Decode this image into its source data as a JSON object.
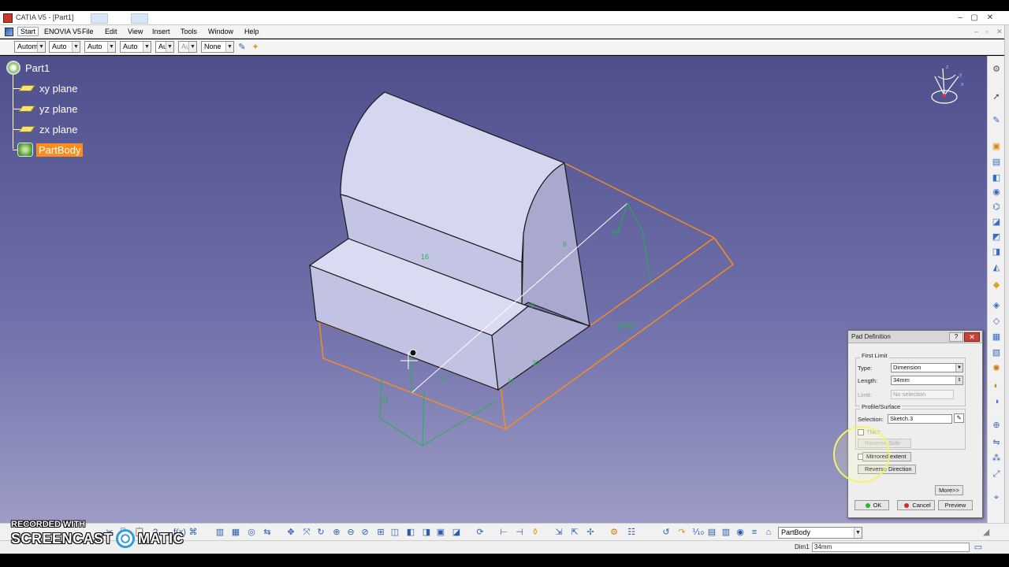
{
  "window": {
    "title": "CATIA V5 - [Part1]",
    "controls": [
      "–",
      "▢",
      "✕"
    ],
    "mdi_controls": [
      "–",
      "▫",
      "✕"
    ]
  },
  "menu": {
    "items": [
      "Start",
      "ENOVIA V5",
      "File",
      "Edit",
      "View",
      "Insert",
      "Tools",
      "Window",
      "Help"
    ]
  },
  "toolbar": {
    "combos": [
      {
        "value": "Automa",
        "disabled": false
      },
      {
        "value": "Auto",
        "disabled": false
      },
      {
        "value": "Auto",
        "disabled": false
      },
      {
        "value": "Auto",
        "disabled": false
      },
      {
        "value": "Aut",
        "disabled": false
      },
      {
        "value": "Aut",
        "disabled": true
      },
      {
        "value": "None",
        "disabled": false
      }
    ]
  },
  "tree": {
    "root": "Part1",
    "children": [
      "xy plane",
      "yz plane",
      "zx plane"
    ],
    "body": "PartBody"
  },
  "dimensions": {
    "lim1": "LIM1"
  },
  "dialog": {
    "title": "Pad Definition",
    "help": "?",
    "close": "✕",
    "first_limit": {
      "group": "First Limit",
      "type_label": "Type:",
      "type_value": "Dimension",
      "length_label": "Length:",
      "length_value": "34mm",
      "limit_label": "Limit:",
      "limit_value": "No selection"
    },
    "profile": {
      "group": "Profile/Surface",
      "selection_label": "Selection:",
      "selection_value": "Sketch.3",
      "thick_label": "Thick",
      "reverse_side": "Reverse Side"
    },
    "mirrored_extent": "Mirrored extent",
    "reverse_direction": "Reverse Direction",
    "more": "More>>",
    "ok": "OK",
    "cancel": "Cancel",
    "preview": "Preview"
  },
  "status": {
    "dim_label": "Dim1",
    "dim_value": "34mm",
    "body_select": "PartBody"
  },
  "watermark": {
    "line1": "RECORDED WITH",
    "line2a": "SCREENCAST",
    "line2b": "MATIC"
  },
  "colors": {
    "viewport_top": "#4f4f8c",
    "viewport_bottom": "#9c9cc6",
    "preview_orange": "#ff8c1a",
    "constraint_green": "#22b14c",
    "highlight": "#ff8c1a"
  }
}
